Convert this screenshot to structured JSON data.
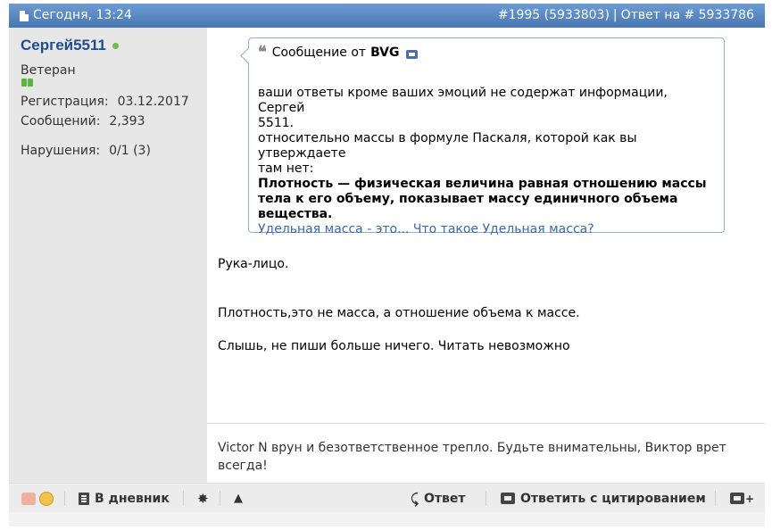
{
  "header": {
    "date": "Сегодня, 13:24",
    "post_number": "#1995 (5933803)",
    "separator": "|",
    "reply_to": "Ответ на # 5933786"
  },
  "user": {
    "name": "Сергей5511",
    "rank": "Ветеран",
    "registration_label": "Регистрация:",
    "registration_value": "03.12.2017",
    "messages_label": "Сообщений:",
    "messages_value": "2,393",
    "violations_label": "Нарушения:",
    "violations_value": "0/1 (3)"
  },
  "quote": {
    "prefix": "Сообщение от",
    "author": "BVG",
    "line1": "ваши ответы кроме ваших эмоций не содержат информации, Сергей",
    "line2": "5511.",
    "line3": "относительно массы в формуле Паскаля, которой как вы утверждаете",
    "line4": "там нет:",
    "bold1": "Плотность — физическая величина равная отношению массы",
    "bold2": "тела к его объему, показывает массу единичного объема",
    "bold3": "вещества.",
    "link": "Удельная масса - это... Что такое Удельная масса?"
  },
  "message": {
    "line1": "Рука-лицо.",
    "line2": "Плотность,это не масса, а отношение объема к массе.",
    "line3": "Слышь, не пиши больше ничего. Читать невозможно"
  },
  "signature": {
    "line1": "Victor N врун и безответственное трепло. Будьте внимательны, Виктор врет",
    "line2": "всегда!"
  },
  "footer": {
    "diary": "В дневник",
    "star_glyph": "✸",
    "warn_glyph": "▲",
    "reply_glyph": "⤹",
    "reply": "Ответ",
    "reply_quote": "Ответить с цитированием",
    "multiquote_glyph": "+"
  },
  "icons": {
    "date": "document-icon",
    "online": "online-status-icon",
    "quote": "quote-marks-icon",
    "view_post": "view-post-icon",
    "thanks": "thumb-up-icon",
    "smile": "smiley-icon",
    "diary": "diary-icon",
    "star": "star-icon",
    "report": "warning-icon",
    "reply": "reply-arrow-icon",
    "reply_quote": "quote-bubble-icon",
    "multiquote": "multiquote-icon"
  },
  "colors": {
    "header_top": "#6d9bd1",
    "header_bottom": "#4876b3",
    "username": "#1f4e8c",
    "online": "#6dbd4a",
    "link": "#3b6ab0",
    "quote_border": "#8fb0d8"
  }
}
